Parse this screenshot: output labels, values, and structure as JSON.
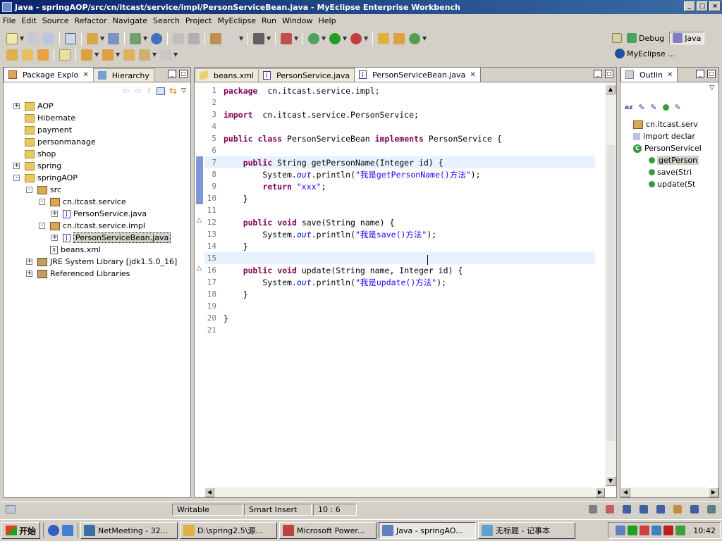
{
  "window": {
    "title": "Java - springAOP/src/cn/itcast/service/impl/PersonServiceBean.java - MyEclipse Enterprise Workbench",
    "minimize": "_",
    "maximize": "□",
    "close": "×"
  },
  "menu": [
    "File",
    "Edit",
    "Source",
    "Refactor",
    "Navigate",
    "Search",
    "Project",
    "MyEclipse",
    "Run",
    "Window",
    "Help"
  ],
  "perspectives": {
    "debug": "Debug",
    "java": "Java",
    "myeclipse": "MyEclipse ..."
  },
  "package_explorer": {
    "tabs": [
      "Package Explo",
      "Hierarchy"
    ],
    "items": [
      {
        "label": "AOP",
        "indent": 0,
        "exp": "+",
        "icon": "folder"
      },
      {
        "label": "Hibernate",
        "indent": 0,
        "exp": "",
        "icon": "folder"
      },
      {
        "label": "payment",
        "indent": 0,
        "exp": "",
        "icon": "folder"
      },
      {
        "label": "personmanage",
        "indent": 0,
        "exp": "",
        "icon": "folder"
      },
      {
        "label": "shop",
        "indent": 0,
        "exp": "",
        "icon": "folder"
      },
      {
        "label": "spring",
        "indent": 0,
        "exp": "+",
        "icon": "folder"
      },
      {
        "label": "springAOP",
        "indent": 0,
        "exp": "-",
        "icon": "folder"
      },
      {
        "label": "src",
        "indent": 1,
        "exp": "-",
        "icon": "pkg"
      },
      {
        "label": "cn.itcast.service",
        "indent": 2,
        "exp": "-",
        "icon": "pkg"
      },
      {
        "label": "PersonService.java",
        "indent": 3,
        "exp": "+",
        "icon": "jfile"
      },
      {
        "label": "cn.itcast.service.impl",
        "indent": 2,
        "exp": "-",
        "icon": "pkg"
      },
      {
        "label": "PersonServiceBean.java",
        "indent": 3,
        "exp": "+",
        "icon": "jfile",
        "selected": true
      },
      {
        "label": "beans.xml",
        "indent": 2,
        "exp": "",
        "icon": "xfile"
      },
      {
        "label": "JRE System Library [jdk1.5.0_16]",
        "indent": 1,
        "exp": "+",
        "icon": "lib"
      },
      {
        "label": "Referenced Libraries",
        "indent": 1,
        "exp": "+",
        "icon": "lib"
      }
    ]
  },
  "editor": {
    "tabs": [
      {
        "label": "beans.xml",
        "active": false
      },
      {
        "label": "PersonService.java",
        "active": false
      },
      {
        "label": "PersonServiceBean.java",
        "active": true
      }
    ],
    "lines": [
      {
        "n": "1",
        "code": [
          [
            "kw",
            "package"
          ],
          [
            "",
            "  cn.itcast.service.impl;"
          ]
        ]
      },
      {
        "n": "2",
        "code": []
      },
      {
        "n": "3",
        "code": [
          [
            "kw",
            "import"
          ],
          [
            "",
            "  cn.itcast.service.PersonService;"
          ]
        ]
      },
      {
        "n": "4",
        "code": []
      },
      {
        "n": "5",
        "code": [
          [
            "kw",
            "public"
          ],
          [
            "",
            " "
          ],
          [
            "kw",
            "class"
          ],
          [
            "",
            " PersonServiceBean "
          ],
          [
            "kw",
            "implements"
          ],
          [
            "",
            " PersonService {"
          ]
        ]
      },
      {
        "n": "6",
        "code": []
      },
      {
        "n": "7",
        "code": [
          [
            "",
            "    "
          ],
          [
            "kw",
            "public"
          ],
          [
            "",
            " String getPersonName(Integer id) {"
          ]
        ],
        "hl": true
      },
      {
        "n": "8",
        "code": [
          [
            "",
            "        System."
          ],
          [
            "fld",
            "out"
          ],
          [
            "",
            ".println("
          ],
          [
            "str",
            "\"我是getPersonName()方法\""
          ],
          [
            "",
            ");"
          ]
        ]
      },
      {
        "n": "9",
        "code": [
          [
            "",
            "        "
          ],
          [
            "kw",
            "return"
          ],
          [
            "",
            " "
          ],
          [
            "str",
            "\"xxx\""
          ],
          [
            "",
            ";"
          ]
        ]
      },
      {
        "n": "10",
        "code": [
          [
            "",
            "    }"
          ]
        ]
      },
      {
        "n": "11",
        "code": []
      },
      {
        "n": "12",
        "code": [
          [
            "",
            "    "
          ],
          [
            "kw",
            "public"
          ],
          [
            "",
            " "
          ],
          [
            "kw",
            "void"
          ],
          [
            "",
            " save(String name) {"
          ]
        ]
      },
      {
        "n": "13",
        "code": [
          [
            "",
            "        System."
          ],
          [
            "fld",
            "out"
          ],
          [
            "",
            ".println("
          ],
          [
            "str",
            "\"我是save()方法\""
          ],
          [
            "",
            ");"
          ]
        ]
      },
      {
        "n": "14",
        "code": [
          [
            "",
            "    }"
          ]
        ]
      },
      {
        "n": "15",
        "code": [],
        "hl": true
      },
      {
        "n": "16",
        "code": [
          [
            "",
            "    "
          ],
          [
            "kw",
            "public"
          ],
          [
            "",
            " "
          ],
          [
            "kw",
            "void"
          ],
          [
            "",
            " update(String name, Integer id) {"
          ]
        ]
      },
      {
        "n": "17",
        "code": [
          [
            "",
            "        System."
          ],
          [
            "fld",
            "out"
          ],
          [
            "",
            ".println("
          ],
          [
            "str",
            "\"我是update()方法\""
          ],
          [
            "",
            ");"
          ]
        ]
      },
      {
        "n": "18",
        "code": [
          [
            "",
            "    }"
          ]
        ]
      },
      {
        "n": "19",
        "code": []
      },
      {
        "n": "20",
        "code": [
          [
            "",
            "}"
          ]
        ]
      },
      {
        "n": "21",
        "code": []
      }
    ]
  },
  "outline": {
    "tab": "Outlin",
    "items": [
      {
        "label": "cn.itcast.serv",
        "indent": 1,
        "icon": "pkg"
      },
      {
        "label": "import declar",
        "indent": 1,
        "icon": "imp",
        "exp": "+"
      },
      {
        "label": "PersonServiceI",
        "indent": 1,
        "icon": "class",
        "exp": "-"
      },
      {
        "label": "getPerson",
        "indent": 2,
        "icon": "method",
        "selected": true
      },
      {
        "label": "save(Stri",
        "indent": 2,
        "icon": "method"
      },
      {
        "label": "update(St",
        "indent": 2,
        "icon": "method"
      }
    ]
  },
  "status": {
    "writable": "Writable",
    "insert": "Smart Insert",
    "position": "10 : 6"
  },
  "taskbar": {
    "start": "开始",
    "tasks": [
      {
        "label": "NetMeeting - 32...",
        "active": false
      },
      {
        "label": "D:\\spring2.5\\源...",
        "active": false
      },
      {
        "label": "Microsoft Power...",
        "active": false
      },
      {
        "label": "Java - springAO...",
        "active": true
      },
      {
        "label": "无标题 - 记事本",
        "active": false
      }
    ],
    "clock": "10:42"
  }
}
